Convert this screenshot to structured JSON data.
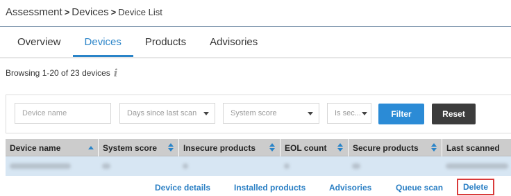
{
  "breadcrumb": {
    "item1": "Assessment",
    "sep1": ">",
    "item2": "Devices",
    "sep2": ">",
    "current": "Device List"
  },
  "tabs": [
    {
      "label": "Overview",
      "active": false
    },
    {
      "label": "Devices",
      "active": true
    },
    {
      "label": "Products",
      "active": false
    },
    {
      "label": "Advisories",
      "active": false
    }
  ],
  "browsing": {
    "text": "Browsing 1-20 of 23 devices",
    "icon": "info-icon"
  },
  "filters": {
    "device_name_placeholder": "Device name",
    "days_since_last_scan": "Days since last scan",
    "system_score": "System score",
    "is_secure": "Is sec..."
  },
  "buttons": {
    "filter": "Filter",
    "reset": "Reset"
  },
  "table": {
    "columns": [
      {
        "label": "Device name",
        "sort": "asc"
      },
      {
        "label": "System score",
        "sort": "both"
      },
      {
        "label": "Insecure products",
        "sort": "both"
      },
      {
        "label": "EOL count",
        "sort": "both"
      },
      {
        "label": "Secure products",
        "sort": "both"
      },
      {
        "label": "Last scanned",
        "sort": "none"
      }
    ]
  },
  "row_actions": {
    "device_details": "Device details",
    "installed_products": "Installed products",
    "advisories": "Advisories",
    "queue_scan": "Queue scan",
    "delete": "Delete"
  },
  "colors": {
    "accent": "#2a84c8",
    "selected_row": "#d7e6f3",
    "header_bg": "#cccccc",
    "highlight_border": "#d93a3a",
    "reset_button": "#3c3c3c"
  }
}
